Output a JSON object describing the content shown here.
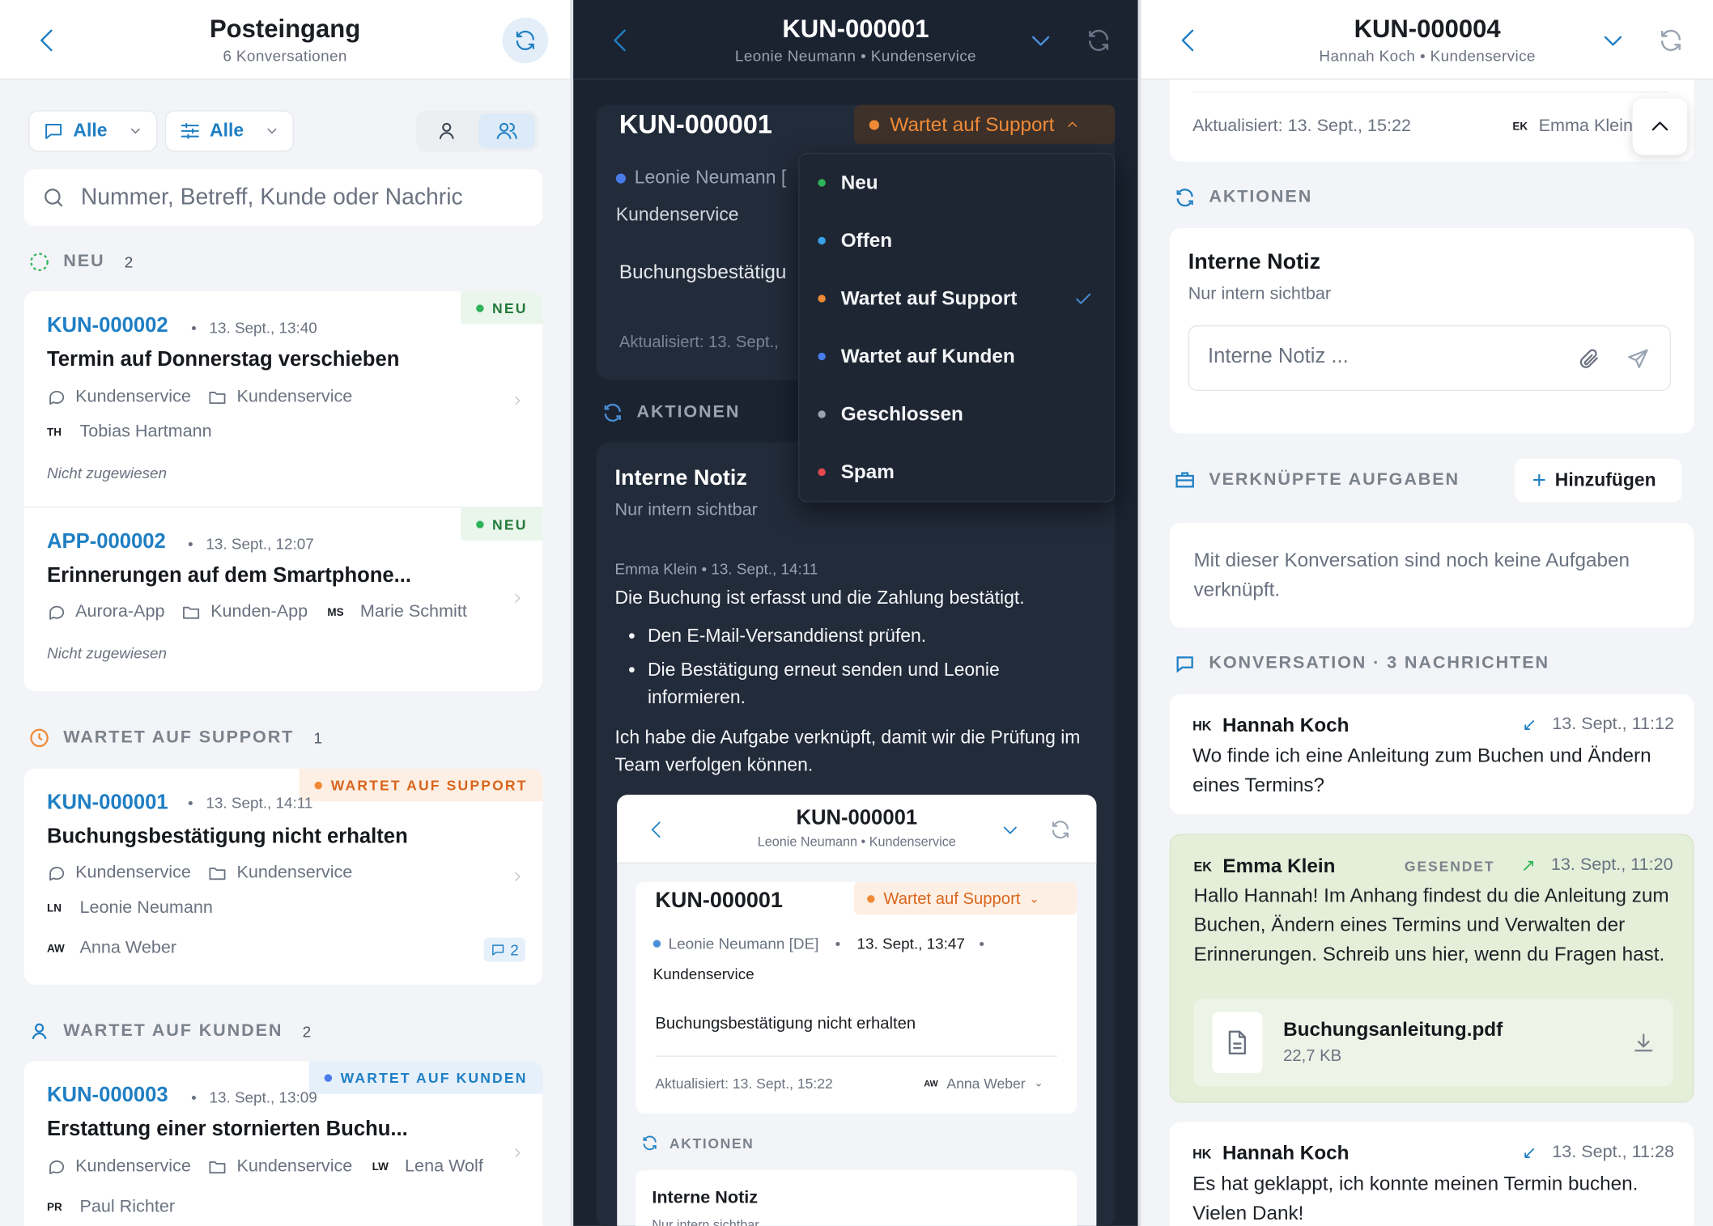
{
  "inbox": {
    "title": "Posteingang",
    "subtitle": "6 Konversationen",
    "filter_channel": "Alle",
    "filter_options": "Alle",
    "search_placeholder": "Nummer, Betreff, Kunde oder Nachric",
    "sections": {
      "neu": {
        "label": "NEU",
        "count": "2"
      },
      "sup": {
        "label": "WARTET AUF SUPPORT",
        "count": "1"
      },
      "kun": {
        "label": "WARTET AUF KUNDEN",
        "count": "2"
      }
    },
    "items": [
      {
        "id": "KUN-000002",
        "date": "13. Sept., 13:40",
        "subject": "Termin auf Donnerstag verschieben",
        "channel": "Kundenservice",
        "folder": "Kundenservice",
        "customer_initials": "TH",
        "customer": "Tobias Hartmann",
        "assignee": "Nicht zugewiesen",
        "badge": "NEU"
      },
      {
        "id": "APP-000002",
        "date": "13. Sept., 12:07",
        "subject": "Erinnerungen auf dem Smartphone...",
        "channel": "Aurora-App",
        "folder": "Kunden-App",
        "customer_initials": "MS",
        "customer": "Marie Schmitt",
        "assignee": "Nicht zugewiesen",
        "badge": "NEU"
      },
      {
        "id": "KUN-000001",
        "date": "13. Sept., 14:11",
        "subject": "Buchungsbestätigung nicht erhalten",
        "channel": "Kundenservice",
        "folder": "Kundenservice",
        "customer_initials": "LN",
        "customer": "Leonie Neumann",
        "agent_initials": "AW",
        "agent": "Anna Weber",
        "msg_count": "2",
        "badge": "WARTET AUF SUPPORT"
      },
      {
        "id": "KUN-000003",
        "date": "13. Sept., 13:09",
        "subject": "Erstattung einer stornierten Buchu...",
        "channel": "Kundenservice",
        "folder": "Kundenservice",
        "customer_initials": "LW",
        "customer": "Lena Wolf",
        "agent_initials": "PR",
        "agent": "Paul Richter",
        "badge": "WARTET AUF KUNDEN"
      }
    ]
  },
  "detail": {
    "title": "KUN-000001",
    "subtitle": "Leonie Neumann • Kundenservice",
    "ticket_id": "KUN-000001",
    "status": "Wartet auf Support",
    "customer": "Leonie Neumann [",
    "department": "Kundenservice",
    "subject": "Buchungsbestätigu",
    "updated": "Aktualisiert: 13. Sept.,",
    "actions_label": "AKTIONEN",
    "note_title": "Interne Notiz",
    "note_sub": "Nur intern sichtbar",
    "menu": [
      {
        "label": "Neu",
        "color": "#2fb35a"
      },
      {
        "label": "Offen",
        "color": "#3aa0e8"
      },
      {
        "label": "Wartet auf Support",
        "color": "#f08a37"
      },
      {
        "label": "Wartet auf Kunden",
        "color": "#4a7ce8"
      },
      {
        "label": "Geschlossen",
        "color": "#9aa3b2"
      },
      {
        "label": "Spam",
        "color": "#e5484d"
      }
    ],
    "note": {
      "author": "Emma Klein • 13. Sept., 14:11",
      "text": "Die Buchung ist erfasst und die Zahlung bestätigt.",
      "b1": "Den E-Mail-Versanddienst prüfen.",
      "b2": "Die Bestätigung erneut senden und Leonie informieren.",
      "text2": "Ich habe die Aufgabe verknüpft, damit wir die Prüfung im Team verfolgen können."
    },
    "shot": {
      "title": "KUN-000001",
      "subtitle": "Leonie Neumann • Kundenservice",
      "ticket_id": "KUN-000001",
      "status": "Wartet auf Support",
      "customer": "Leonie Neumann [DE]",
      "date": "13. Sept., 13:47",
      "department": "Kundenservice",
      "subject": "Buchungsbestätigung nicht erhalten",
      "updated": "Aktualisiert: 13. Sept., 15:22",
      "agent_initials": "AW",
      "agent": "Anna Weber",
      "actions_label": "AKTIONEN",
      "note_title": "Interne Notiz",
      "note_sub": "Nur intern sichtbar"
    }
  },
  "conv": {
    "title": "KUN-000004",
    "subtitle": "Hannah Koch • Kundenservice",
    "updated": "Aktualisiert: 13. Sept., 15:22",
    "agent_initials": "EK",
    "agent": "Emma Klein",
    "actions_label": "AKTIONEN",
    "note_title": "Interne Notiz",
    "note_sub": "Nur intern sichtbar",
    "note_placeholder": "Interne Notiz ...",
    "tasks_label": "VERKNÜPFTE AUFGABEN",
    "add_label": "Hinzufügen",
    "tasks_empty": "Mit dieser Konversation sind noch keine Aufgaben verknüpft.",
    "conv_label": "KONVERSATION · 3 NACHRICHTEN",
    "messages": [
      {
        "initials": "HK",
        "name": "Hannah Koch",
        "time": "13. Sept., 11:12",
        "text": "Wo finde ich eine Anleitung zum Buchen und Ändern eines Termins?"
      },
      {
        "initials": "EK",
        "name": "Emma Klein",
        "sent": "GESENDET",
        "time": "13. Sept., 11:20",
        "text": "Hallo Hannah! Im Anhang findest du die Anleitung zum Buchen, Ändern eines Termins und Verwalten der Erinnerungen. Schreib uns hier, wenn du Fragen hast.",
        "file": "Buchungsanleitung.pdf",
        "size": "22,7 KB"
      },
      {
        "initials": "HK",
        "name": "Hannah Koch",
        "time": "13. Sept., 11:28",
        "text": "Es hat geklappt, ich konnte meinen Termin buchen. Vielen Dank!"
      }
    ]
  }
}
